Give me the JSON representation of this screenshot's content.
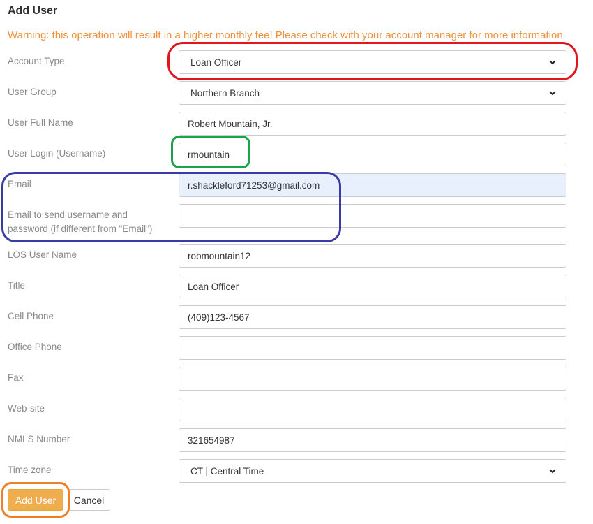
{
  "form": {
    "title": "Add User",
    "warning": "Warning: this operation will result in a higher monthly fee! Please check with your account manager for more information",
    "account_type": {
      "label": "Account Type",
      "value": "Loan Officer"
    },
    "user_group": {
      "label": "User Group",
      "value": "Northern Branch"
    },
    "full_name": {
      "label": "User Full Name",
      "value": "Robert Mountain, Jr."
    },
    "login": {
      "label": "User Login (Username)",
      "value": "rmountain"
    },
    "email": {
      "label": "Email",
      "value": "r.shackleford71253@gmail.com"
    },
    "email_send": {
      "label": "Email to send username and password (if different from \"Email\")",
      "value": ""
    },
    "los_user": {
      "label": "LOS User Name",
      "value": "robmountain12"
    },
    "title_field": {
      "label": "Title",
      "value": "Loan Officer"
    },
    "cell_phone": {
      "label": "Cell Phone",
      "value": "(409)123-4567"
    },
    "office_phone": {
      "label": "Office Phone",
      "value": ""
    },
    "fax": {
      "label": "Fax",
      "value": ""
    },
    "website": {
      "label": "Web-site",
      "value": ""
    },
    "nmls": {
      "label": "NMLS Number",
      "value": "321654987"
    },
    "timezone": {
      "label": "Time zone",
      "value": "CT | Central Time"
    }
  },
  "buttons": {
    "add": "Add User",
    "cancel": "Cancel"
  },
  "colors": {
    "warning": "#f0913c",
    "primary_button": "#f0ad4e",
    "highlight_red": "#e0151e",
    "highlight_green": "#1aa34a",
    "highlight_blue": "#3b3ba8",
    "highlight_orange": "#f07e26"
  }
}
